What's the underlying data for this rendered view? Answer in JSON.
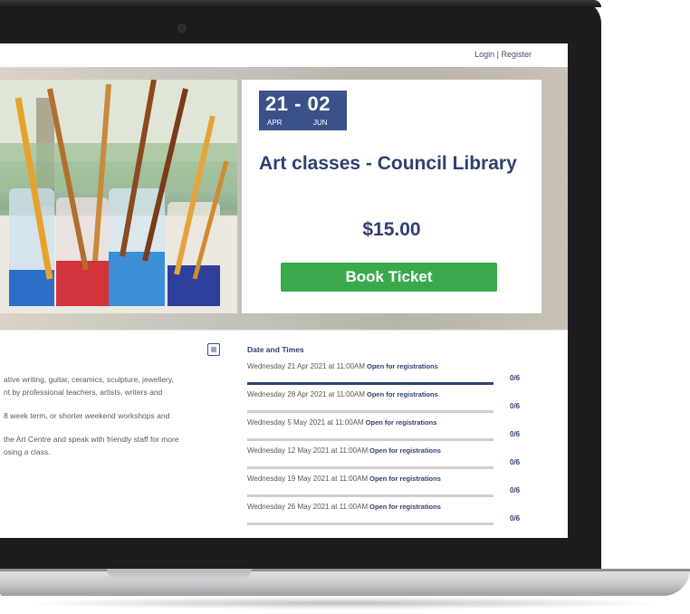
{
  "header": {
    "login_label": "Login",
    "separator": "|",
    "register_label": "Register"
  },
  "event": {
    "date_range": "21 - 02",
    "start_month": "APR",
    "end_month": "JUN",
    "title": "Art classes - Council Library",
    "price": "$15.00",
    "book_button_label": "Book Ticket"
  },
  "description": {
    "paragraphs": [
      "ative writing, guitar, ceramics, sculpture, jewellery,",
      "nt by professional teachers, artists, writers and",
      "",
      "8 week term, or shorter weekend workshops and",
      "",
      "the Art Centre and speak with friendly staff for more",
      "osing a class."
    ]
  },
  "dates_times": {
    "title": "Date and Times",
    "rows": [
      {
        "date": "Wednesday 21 Apr 2021 at 11:00AM",
        "status": "Open for registrations",
        "count": "0/6",
        "active": true
      },
      {
        "date": "Wednesday 28 Apr 2021 at 11:00AM",
        "status": "Open for registrations",
        "count": "0/6",
        "active": false
      },
      {
        "date": "Wednesday 5 May 2021 at 11:00AM",
        "status": "Open for registrations",
        "count": "0/6",
        "active": false
      },
      {
        "date": "Wednesday 12 May 2021 at 11:00AM",
        "status": "Open for registrations",
        "count": "0/6",
        "active": false
      },
      {
        "date": "Wednesday 19 May 2021 at 11:00AM",
        "status": "Open for registrations",
        "count": "0/6",
        "active": false
      },
      {
        "date": "Wednesday 26 May 2021 at 11:00AM",
        "status": "Open for registrations",
        "count": "0/6",
        "active": false
      }
    ]
  },
  "icons": {
    "calendar": "calendar-icon",
    "photo": "paint-brushes-photo"
  },
  "colors": {
    "primary": "#3c5189",
    "title": "#2f3f70",
    "button": "#3aa94c"
  }
}
